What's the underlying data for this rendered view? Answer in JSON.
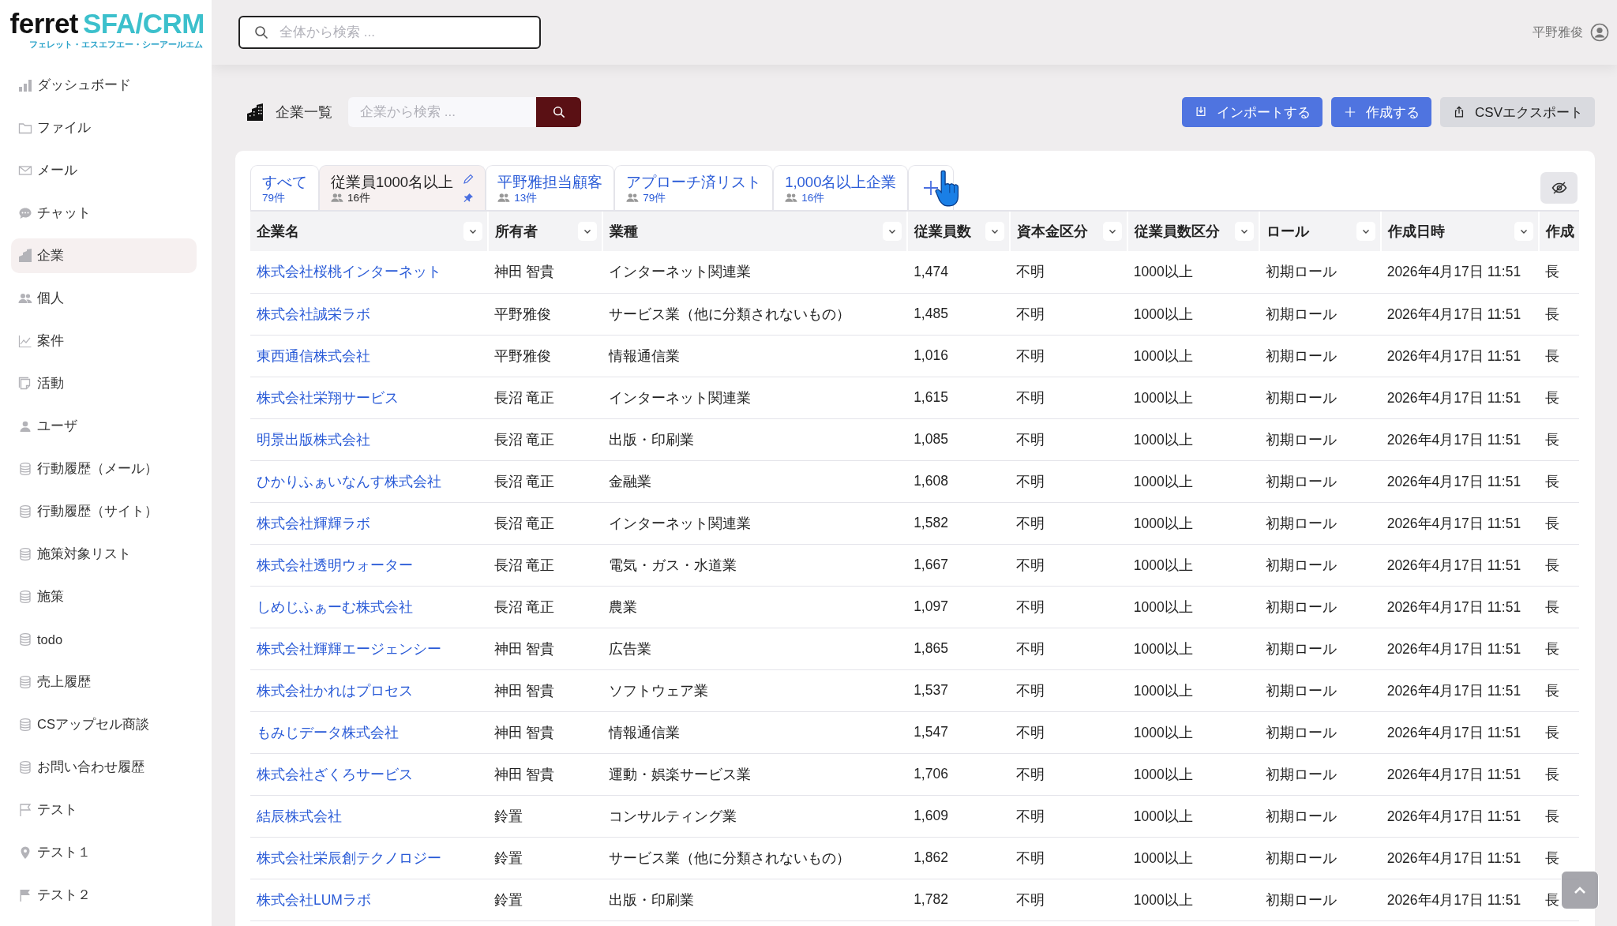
{
  "logo": {
    "name": "ferret",
    "product": "SFA/CRM",
    "reading": "フェレット・エスエフエー・シーアールエム"
  },
  "global_search": {
    "placeholder": "全体から検索 ..."
  },
  "user": {
    "name": "平野雅俊"
  },
  "sidebar": {
    "items": [
      {
        "label": "ダッシュボード",
        "kind": "dashboard",
        "selected": false
      },
      {
        "label": "ファイル",
        "kind": "file",
        "selected": false
      },
      {
        "label": "メール",
        "kind": "mail",
        "selected": false
      },
      {
        "label": "チャット",
        "kind": "chat",
        "selected": false
      },
      {
        "label": "企業",
        "kind": "company",
        "selected": true
      },
      {
        "label": "個人",
        "kind": "people",
        "selected": false
      },
      {
        "label": "案件",
        "kind": "deal",
        "selected": false
      },
      {
        "label": "活動",
        "kind": "activity",
        "selected": false
      },
      {
        "label": "ユーザ",
        "kind": "user",
        "selected": false
      },
      {
        "label": "行動履歴（メール）",
        "kind": "database",
        "selected": false
      },
      {
        "label": "行動履歴（サイト）",
        "kind": "database",
        "selected": false
      },
      {
        "label": "施策対象リスト",
        "kind": "database",
        "selected": false
      },
      {
        "label": "施策",
        "kind": "database",
        "selected": false
      },
      {
        "label": "todo",
        "kind": "database",
        "selected": false
      },
      {
        "label": "売上履歴",
        "kind": "database",
        "selected": false
      },
      {
        "label": "CSアップセル商談",
        "kind": "database",
        "selected": false
      },
      {
        "label": "お問い合わせ履歴",
        "kind": "database",
        "selected": false
      },
      {
        "label": "テスト",
        "kind": "flag",
        "selected": false
      },
      {
        "label": "テスト１",
        "kind": "pin",
        "selected": false
      },
      {
        "label": "テスト２",
        "kind": "flag-filled",
        "selected": false
      }
    ]
  },
  "page": {
    "title": "企業一覧",
    "search": {
      "placeholder": "企業から検索 ..."
    },
    "actions": [
      {
        "label": "インポートする",
        "kind": "import"
      },
      {
        "label": "作成する",
        "kind": "create"
      },
      {
        "label": "CSVエクスポート",
        "kind": "export"
      }
    ]
  },
  "tabs": [
    {
      "label": "すべて",
      "count": "79件",
      "kind": "all",
      "selected": false
    },
    {
      "label": "従業員1000名以上",
      "count": "16件",
      "kind": "view",
      "selected": true
    },
    {
      "label": "平野雅担当顧客",
      "count": "13件",
      "kind": "view",
      "selected": false
    },
    {
      "label": "アプローチ済リスト",
      "count": "79件",
      "kind": "view",
      "selected": false
    },
    {
      "label": "1,000名以上企業",
      "count": "16件",
      "kind": "view",
      "selected": false
    }
  ],
  "table": {
    "columns": [
      {
        "label": "企業名",
        "kind": "link",
        "sortable": true
      },
      {
        "label": "所有者",
        "kind": "text",
        "sortable": true
      },
      {
        "label": "業種",
        "kind": "text",
        "sortable": true
      },
      {
        "label": "従業員数",
        "kind": "text",
        "sortable": true
      },
      {
        "label": "資本金区分",
        "kind": "text",
        "sortable": true
      },
      {
        "label": "従業員数区分",
        "kind": "text",
        "sortable": true
      },
      {
        "label": "ロール",
        "kind": "text",
        "sortable": true
      },
      {
        "label": "作成日時",
        "kind": "text",
        "sortable": true
      },
      {
        "label": "作成",
        "kind": "text",
        "sortable": false
      }
    ],
    "rows": [
      [
        "株式会社桜桃インターネット",
        "神田 智貴",
        "インターネット関連業",
        "1,474",
        "不明",
        "1000以上",
        "初期ロール",
        "2026年4月17日 11:51",
        "長"
      ],
      [
        "株式会社誠栄ラボ",
        "平野雅俊",
        "サービス業（他に分類されないもの）",
        "1,485",
        "不明",
        "1000以上",
        "初期ロール",
        "2026年4月17日 11:51",
        "長"
      ],
      [
        "東西通信株式会社",
        "平野雅俊",
        "情報通信業",
        "1,016",
        "不明",
        "1000以上",
        "初期ロール",
        "2026年4月17日 11:51",
        "長"
      ],
      [
        "株式会社栄翔サービス",
        "長沼 竜正",
        "インターネット関連業",
        "1,615",
        "不明",
        "1000以上",
        "初期ロール",
        "2026年4月17日 11:51",
        "長"
      ],
      [
        "明景出版株式会社",
        "長沼 竜正",
        "出版・印刷業",
        "1,085",
        "不明",
        "1000以上",
        "初期ロール",
        "2026年4月17日 11:51",
        "長"
      ],
      [
        "ひかりふぁいなんす株式会社",
        "長沼 竜正",
        "金融業",
        "1,608",
        "不明",
        "1000以上",
        "初期ロール",
        "2026年4月17日 11:51",
        "長"
      ],
      [
        "株式会社輝輝ラボ",
        "長沼 竜正",
        "インターネット関連業",
        "1,582",
        "不明",
        "1000以上",
        "初期ロール",
        "2026年4月17日 11:51",
        "長"
      ],
      [
        "株式会社透明ウォーター",
        "長沼 竜正",
        "電気・ガス・水道業",
        "1,667",
        "不明",
        "1000以上",
        "初期ロール",
        "2026年4月17日 11:51",
        "長"
      ],
      [
        "しめじふぁーむ株式会社",
        "長沼 竜正",
        "農業",
        "1,097",
        "不明",
        "1000以上",
        "初期ロール",
        "2026年4月17日 11:51",
        "長"
      ],
      [
        "株式会社輝輝エージェンシー",
        "神田 智貴",
        "広告業",
        "1,865",
        "不明",
        "1000以上",
        "初期ロール",
        "2026年4月17日 11:51",
        "長"
      ],
      [
        "株式会社かれはプロセス",
        "神田 智貴",
        "ソフトウェア業",
        "1,537",
        "不明",
        "1000以上",
        "初期ロール",
        "2026年4月17日 11:51",
        "長"
      ],
      [
        "もみじデータ株式会社",
        "神田 智貴",
        "情報通信業",
        "1,547",
        "不明",
        "1000以上",
        "初期ロール",
        "2026年4月17日 11:51",
        "長"
      ],
      [
        "株式会社ざくろサービス",
        "神田 智貴",
        "運動・娯楽サービス業",
        "1,706",
        "不明",
        "1000以上",
        "初期ロール",
        "2026年4月17日 11:51",
        "長"
      ],
      [
        "結辰株式会社",
        "鈴置",
        "コンサルティング業",
        "1,609",
        "不明",
        "1000以上",
        "初期ロール",
        "2026年4月17日 11:51",
        "長"
      ],
      [
        "株式会社栄辰創テクノロジー",
        "鈴置",
        "サービス業（他に分類されないもの）",
        "1,862",
        "不明",
        "1000以上",
        "初期ロール",
        "2026年4月17日 11:51",
        "長"
      ],
      [
        "株式会社LUMラボ",
        "鈴置",
        "出版・印刷業",
        "1,782",
        "不明",
        "1000以上",
        "初期ロール",
        "2026年4月17日 11:51",
        "長"
      ]
    ]
  }
}
